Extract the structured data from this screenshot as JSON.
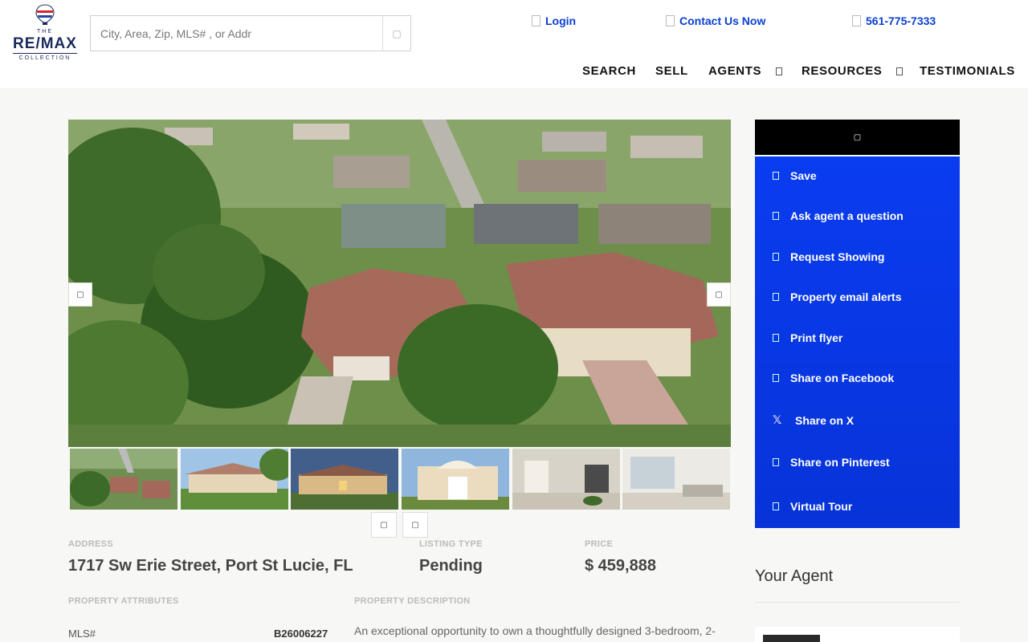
{
  "header": {
    "logo": {
      "the": "THE",
      "brand": "RE/MAX",
      "collection": "COLLECTION",
      "balloon_text": "RE/MAX"
    },
    "search": {
      "placeholder": "City, Area, Zip, MLS# , or Addr",
      "button_icon": "search-icon"
    },
    "top_links": [
      {
        "label": "Login",
        "icon": "user-icon"
      },
      {
        "label": "Contact Us Now",
        "icon": "envelope-icon"
      },
      {
        "label": "561-775-7333",
        "icon": "phone-icon"
      }
    ],
    "nav": [
      "SEARCH",
      "SELL",
      "AGENTS",
      "RESOURCES",
      "TESTIMONIALS"
    ]
  },
  "gallery": {
    "prev_icon": "chevron-left-icon",
    "next_icon": "chevron-right-icon",
    "thumb_count": 6
  },
  "listing": {
    "address_label": "ADDRESS",
    "address": "1717 Sw Erie Street, Port St Lucie, FL",
    "type_label": "LISTING TYPE",
    "type": "Pending",
    "price_label": "PRICE",
    "price": "$ 459,888",
    "attributes_label": "PROPERTY ATTRIBUTES",
    "mls_label": "MLS#",
    "mls": "B26006227",
    "description_label": "PROPERTY DESCRIPTION",
    "description": "An exceptional opportunity to own a thoughtfully designed 3-bedroom, 2-"
  },
  "sidebar": {
    "head_icon": "heart-icon",
    "items": [
      {
        "label": "Save",
        "icon": "heart-icon"
      },
      {
        "label": "Ask agent a question",
        "icon": "question-icon"
      },
      {
        "label": "Request Showing",
        "icon": "calendar-icon"
      },
      {
        "label": "Property email alerts",
        "icon": "bell-icon"
      },
      {
        "label": "Print flyer",
        "icon": "print-icon"
      },
      {
        "label": "Share on Facebook",
        "icon": "facebook-icon"
      },
      {
        "label": "Share on X",
        "icon": "x-icon"
      },
      {
        "label": "Share on Pinterest",
        "icon": "pinterest-icon"
      },
      {
        "label": "Virtual Tour",
        "icon": "video-icon"
      }
    ],
    "agent_title": "Your Agent"
  },
  "colors": {
    "accent": "#0a3fd1",
    "panel": "#0733d8",
    "header_bar": "#000000"
  }
}
